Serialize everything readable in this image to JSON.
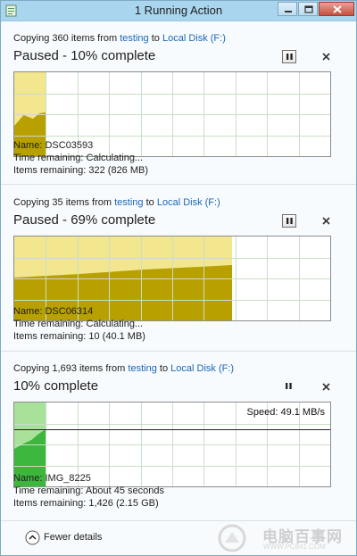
{
  "window": {
    "title": "1 Running Action"
  },
  "colors": {
    "paused_fill": "#b8a000",
    "paused_light": "#f2e68e",
    "active_fill": "#3cb63c",
    "active_light": "#a8e29a",
    "grid": "#c9dfc5",
    "link": "#1a66b8"
  },
  "operations": [
    {
      "copy_prefix": "Copying 360 items from",
      "source": "testing",
      "to_word": "to",
      "destination": "Local Disk (F:)",
      "status": "Paused - 10% complete",
      "state": "paused",
      "progress": 0.1,
      "pause_icon": "pause-icon",
      "close_icon": "close-icon",
      "speed": "",
      "name_label": "Name:",
      "name_value": "DSC03593",
      "time_label": "Time remaining:",
      "time_value": "Calculating...",
      "items_label": "Items remaining:",
      "items_value": "322 (826 MB)"
    },
    {
      "copy_prefix": "Copying 35 items from",
      "source": "testing",
      "to_word": "to",
      "destination": "Local Disk (F:)",
      "status": "Paused - 69% complete",
      "state": "paused",
      "progress": 0.69,
      "pause_icon": "pause-icon",
      "close_icon": "close-icon",
      "speed": "",
      "name_label": "Name:",
      "name_value": "DSC06314",
      "time_label": "Time remaining:",
      "time_value": "Calculating...",
      "items_label": "Items remaining:",
      "items_value": "10 (40.1 MB)"
    },
    {
      "copy_prefix": "Copying 1,693 items from",
      "source": "testing",
      "to_word": "to",
      "destination": "Local Disk (F:)",
      "status": "10% complete",
      "state": "running",
      "progress": 0.1,
      "pause_icon": "pause-icon",
      "close_icon": "close-icon",
      "speed": "Speed: 49.1 MB/s",
      "name_label": "Name:",
      "name_value": "IMG_8225",
      "time_label": "Time remaining:",
      "time_value": "About 45 seconds",
      "items_label": "Items remaining:",
      "items_value": "1,426 (2.15 GB)"
    }
  ],
  "footer": {
    "fewer_details": "Fewer details",
    "watermark_text": "电脑百事网",
    "watermark_url": "WWW.PC841.COM"
  }
}
